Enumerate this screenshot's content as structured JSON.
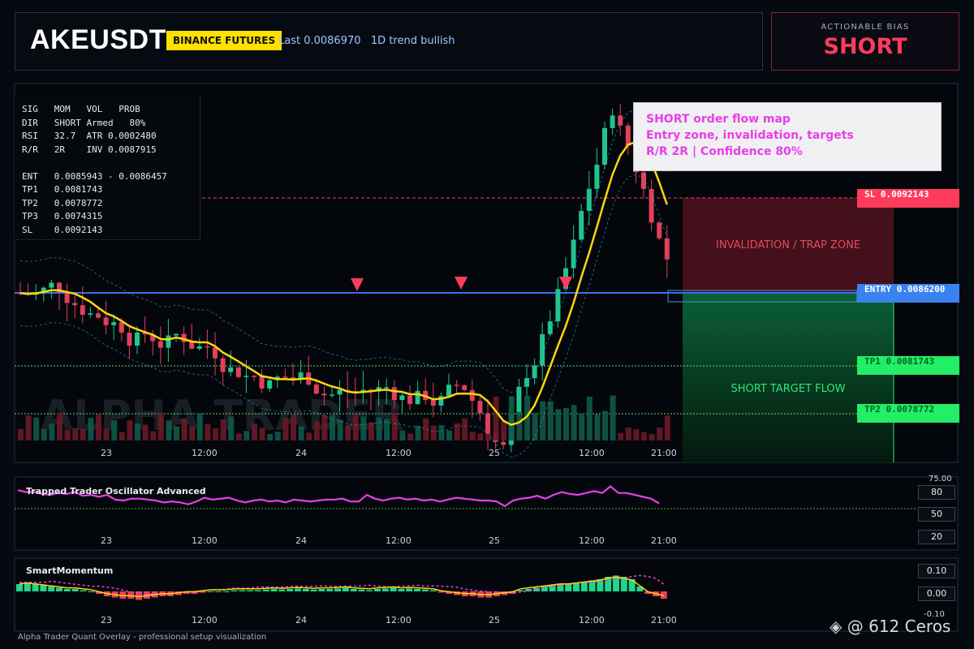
{
  "header": {
    "symbol": "AKEUSDT",
    "exchange": "BINANCE FUTURES",
    "last_text": "Last 0.0086970   1D trend bullish"
  },
  "bias": {
    "label": "ACTIONABLE BIAS",
    "value": "SHORT",
    "color": "#ff3b5c"
  },
  "info_table": {
    "text": "SIG   MOM   VOL   PROB\nDIR   SHORT Armed   80%\nRSI   32.7  ATR 0.0002480\nR/R   2R    INV 0.0087915\n\nENT   0.0085943 - 0.0086457\nTP1   0.0081743\nTP2   0.0078772\nTP3   0.0074315\nSL    0.0092143"
  },
  "note": {
    "line1": "SHORT order flow map",
    "line2": "Entry zone, invalidation, targets",
    "line3": "R/R 2R | Confidence 80%"
  },
  "levels": {
    "sl": {
      "label": "SL 0.0092143",
      "price": 0.0092143,
      "color": "#ff3b5c"
    },
    "entry": {
      "label": "ENTRY 0.0086200",
      "price": 0.00862,
      "color": "#3a82f0"
    },
    "tp1": {
      "label": "TP1 0.0081743",
      "price": 0.0081743,
      "color": "#22ee66"
    },
    "tp2": {
      "label": "TP2 0.0078772",
      "price": 0.0078772,
      "color": "#22ee66"
    }
  },
  "zones": {
    "invalidation": "INVALIDATION / TRAP ZONE",
    "target": "SHORT TARGET FLOW"
  },
  "watermark_bg": "ALPHA TRADER",
  "time_axis": [
    "23",
    "12:00",
    "24",
    "12:00",
    "25",
    "12:00",
    "21:00"
  ],
  "oscillator1": {
    "title": "Trapped Trader Oscillator Advanced",
    "scale": [
      "75.00",
      "80",
      "50",
      "20"
    ],
    "series": [
      73,
      71,
      71,
      69,
      68,
      70,
      69,
      71,
      67,
      68,
      66,
      68,
      63,
      62,
      64,
      64,
      63,
      62,
      60,
      61,
      60,
      58,
      61,
      65,
      63,
      64,
      65,
      62,
      60,
      62,
      63,
      61,
      62,
      60,
      63,
      62,
      61,
      62,
      63,
      63,
      64,
      61,
      61,
      68,
      64,
      62,
      64,
      65,
      63,
      64,
      62,
      63,
      61,
      63,
      65,
      64,
      63,
      62,
      62,
      61,
      56,
      62,
      64,
      65,
      67,
      64,
      68,
      71,
      69,
      68,
      70,
      72,
      70,
      77,
      70,
      70,
      68,
      66,
      64,
      59
    ]
  },
  "oscillator2": {
    "title": "SmartMomentum",
    "scale": [
      "0.10",
      "0.00",
      "-0.10"
    ],
    "histogram": [
      0.03,
      0.035,
      0.03,
      0.025,
      0.02,
      0.015,
      0.01,
      0.01,
      0.005,
      0.0,
      -0.01,
      -0.02,
      -0.025,
      -0.03,
      -0.03,
      -0.035,
      -0.03,
      -0.025,
      -0.02,
      -0.02,
      -0.015,
      -0.01,
      -0.01,
      -0.005,
      0.0,
      0.0,
      0.0,
      0.005,
      0.005,
      0.005,
      0.005,
      0.008,
      0.01,
      0.008,
      0.01,
      0.012,
      0.01,
      0.008,
      0.01,
      0.01,
      0.012,
      0.015,
      0.01,
      0.008,
      0.005,
      0.01,
      0.012,
      0.015,
      0.01,
      0.012,
      0.01,
      0.008,
      0.005,
      -0.005,
      -0.01,
      -0.015,
      -0.02,
      -0.02,
      -0.025,
      -0.025,
      -0.02,
      -0.015,
      -0.01,
      0.005,
      0.01,
      0.015,
      0.02,
      0.025,
      0.03,
      0.03,
      0.035,
      0.04,
      0.045,
      0.05,
      0.06,
      0.065,
      0.06,
      0.05,
      0.02,
      -0.01,
      -0.02,
      -0.03
    ]
  },
  "footer": "Alpha Trader Quant Overlay - professional setup visualization",
  "watermark": "@ 612 Ceros",
  "colors": {
    "up": "#21c48c",
    "down": "#e0405a",
    "ma": "#ffd60a",
    "band": "#3da0c0",
    "osc": "#e83ee8"
  }
}
